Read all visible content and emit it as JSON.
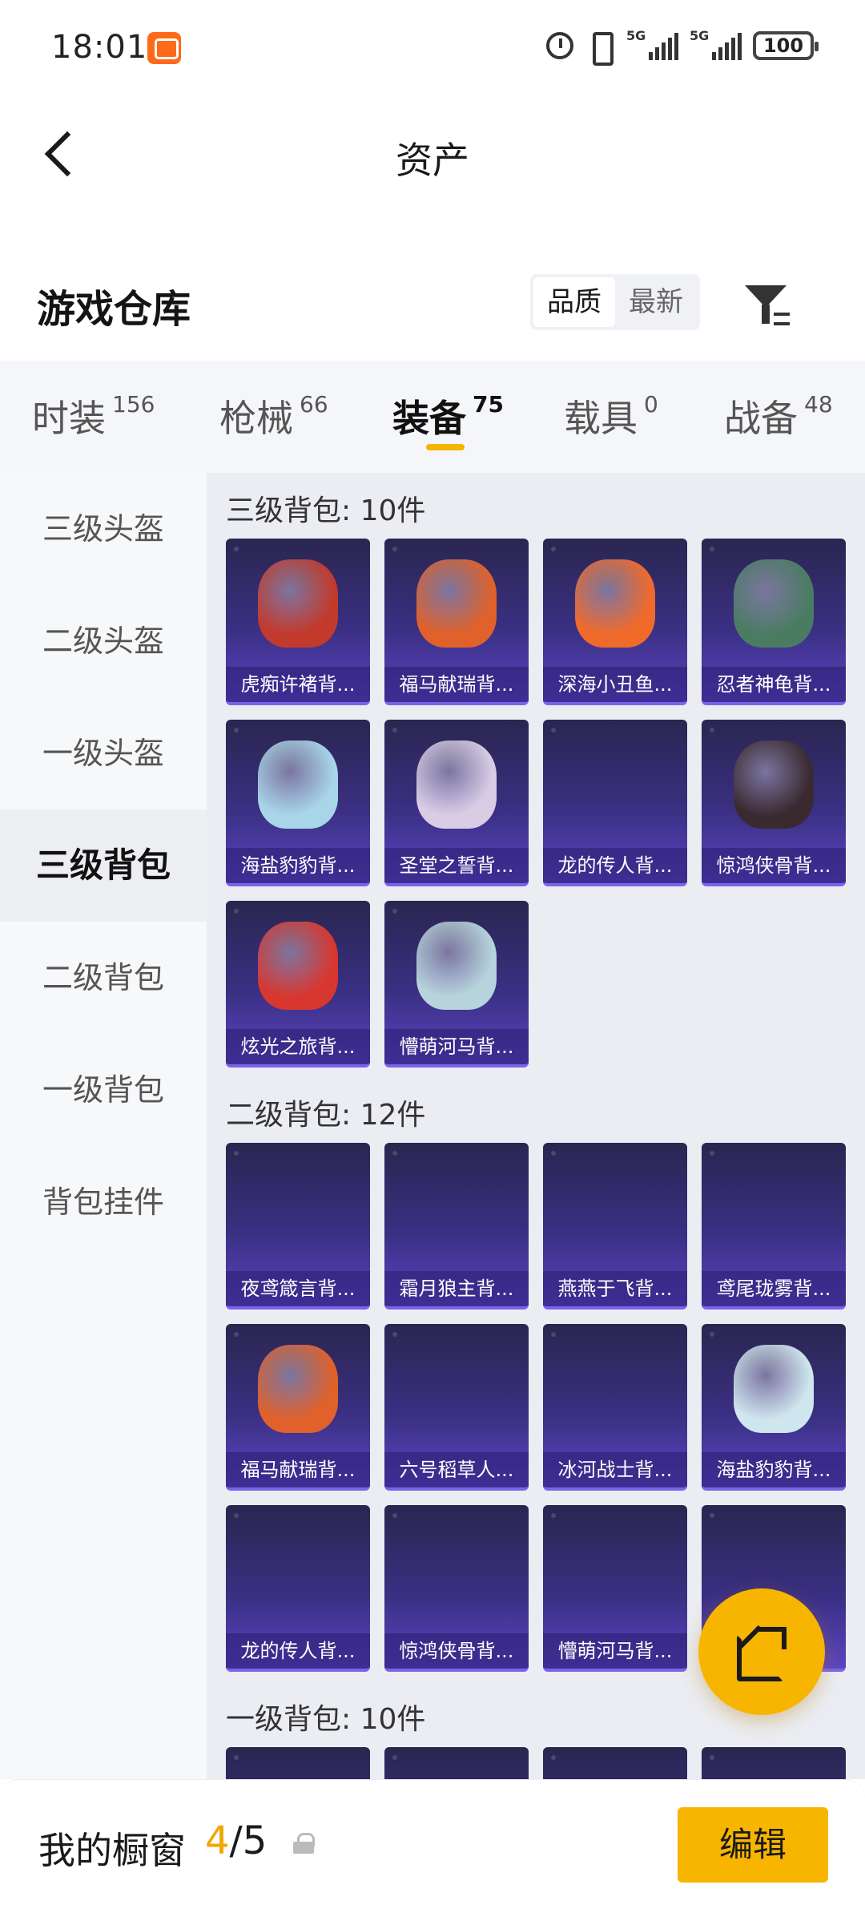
{
  "status_bar": {
    "time": "18:01",
    "network_1": "5G",
    "network_2": "5G",
    "battery": "100"
  },
  "header": {
    "title": "资产"
  },
  "warehouse": {
    "title": "游戏仓库",
    "sort_options": [
      "品质",
      "最新"
    ],
    "active_sort": "品质"
  },
  "tabs": [
    {
      "label": "时装",
      "count": "156"
    },
    {
      "label": "枪械",
      "count": "66"
    },
    {
      "label": "装备",
      "count": "75"
    },
    {
      "label": "载具",
      "count": "0"
    },
    {
      "label": "战备",
      "count": "48"
    }
  ],
  "sidebar": {
    "items": [
      "三级头盔",
      "二级头盔",
      "一级头盔",
      "三级背包",
      "二级背包",
      "一级背包",
      "背包挂件"
    ],
    "active": "三级背包"
  },
  "sections": [
    {
      "title": "三级背包: 10件",
      "items": [
        "虎痴许褚背...",
        "福马献瑞背...",
        "深海小丑鱼...",
        "忍者神龟背...",
        "海盐豹豹背...",
        "圣堂之誓背...",
        "龙的传人背...",
        "惊鸿侠骨背...",
        "炫光之旅背...",
        "懵萌河马背..."
      ]
    },
    {
      "title": "二级背包: 12件",
      "items": [
        "夜鸢箴言背...",
        "霜月狼主背...",
        "燕燕于飞背...",
        "鸢尾珑雾背...",
        "福马献瑞背...",
        "六号稻草人...",
        "冰河战士背...",
        "海盐豹豹背...",
        "龙的传人背...",
        "惊鸿侠骨背...",
        "懵萌河马背...",
        ""
      ]
    },
    {
      "title": "一级背包: 10件",
      "items": [
        "",
        "",
        "",
        ""
      ]
    }
  ],
  "item_art_colors": {
    "0": "#c23a2c",
    "1": "#e0612a",
    "2": "#f06a2a",
    "3": "#4a7c62",
    "4": "#a8d6e8",
    "5": "#d9cde6",
    "7": "#3a2a30",
    "8": "#d8372f",
    "9": "#b7d4dc",
    "10": "",
    "14": "#e0612a",
    "17": "#cfe6ee"
  },
  "bottom_bar": {
    "label": "我的橱窗",
    "current": "4",
    "separator": "/",
    "total": "5",
    "edit_label": "编辑"
  },
  "colors": {
    "accent": "#f7b500",
    "card_gradient_bottom": "#5b45c2"
  }
}
